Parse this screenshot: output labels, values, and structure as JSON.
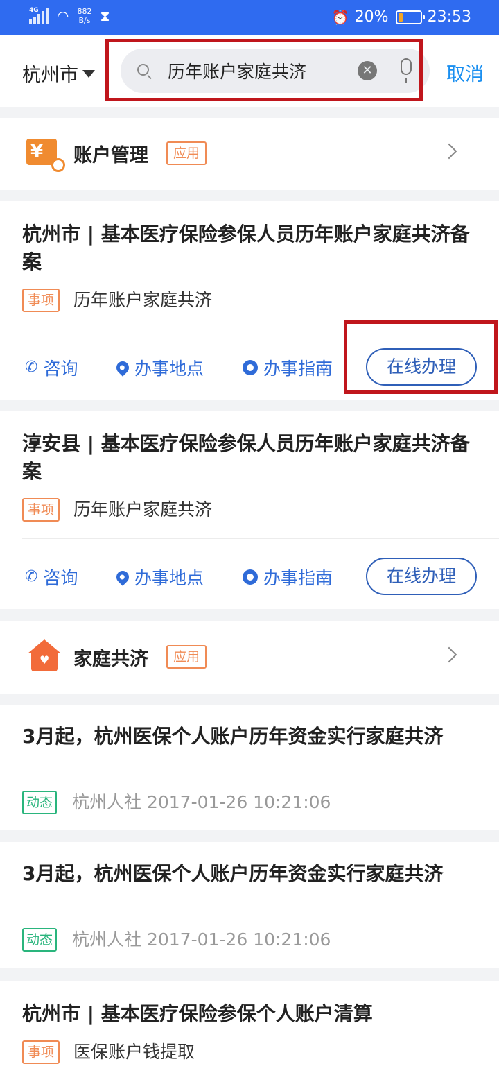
{
  "status_bar": {
    "network": "4G",
    "speed_value": "882",
    "speed_unit": "B/s",
    "battery": "20%",
    "time": "23:53"
  },
  "header": {
    "city": "杭州市",
    "search_value": "历年账户家庭共济",
    "cancel_label": "取消"
  },
  "results": {
    "app1": {
      "title": "账户管理",
      "tag": "应用"
    },
    "item1": {
      "title": "杭州市 | 基本医疗保险参保人员历年账户家庭共济备案",
      "tag": "事项",
      "subtitle": "历年账户家庭共济",
      "actions": {
        "consult": "咨询",
        "location": "办事地点",
        "guide": "办事指南",
        "online": "在线办理"
      }
    },
    "item2": {
      "title": "淳安县 | 基本医疗保险参保人员历年账户家庭共济备案",
      "tag": "事项",
      "subtitle": "历年账户家庭共济",
      "actions": {
        "consult": "咨询",
        "location": "办事地点",
        "guide": "办事指南",
        "online": "在线办理"
      }
    },
    "app2": {
      "title": "家庭共济",
      "tag": "应用"
    },
    "news1": {
      "title": "3月起，杭州医保个人账户历年资金实行家庭共济",
      "tag": "动态",
      "meta": "杭州人社 2017-01-26 10:21:06"
    },
    "news2": {
      "title": "3月起，杭州医保个人账户历年资金实行家庭共济",
      "tag": "动态",
      "meta": "杭州人社 2017-01-26 10:21:06"
    },
    "item3": {
      "title": "杭州市 | 基本医疗保险参保个人账户清算",
      "tag": "事项",
      "subtitle": "医保账户钱提取"
    }
  },
  "colors": {
    "status_bar": "#2f6bf0",
    "accent_blue": "#1a8ff0",
    "action_blue": "#2f6bd8",
    "tag_orange": "#f08b55",
    "tag_green": "#2ab57d",
    "highlight_red": "#c0161c"
  },
  "icons": {
    "app1": "account-money-search-icon",
    "app2": "home-heart-icon",
    "consult": "phone-icon",
    "location": "location-pin-icon",
    "guide": "compass-icon"
  }
}
